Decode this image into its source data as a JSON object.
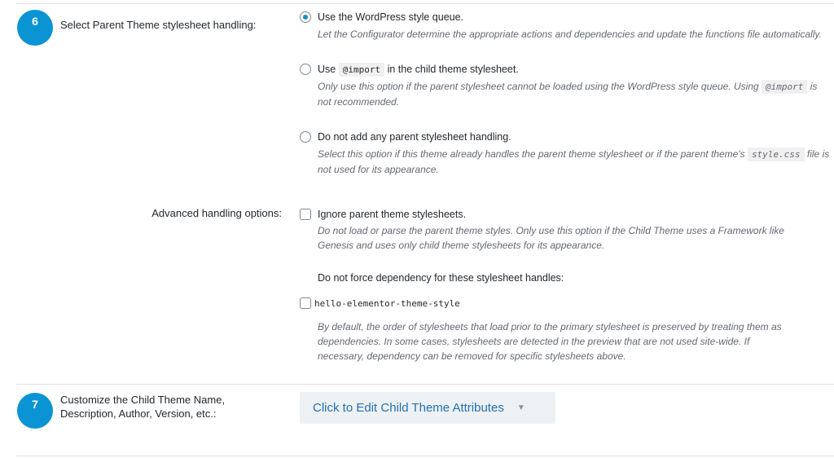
{
  "step6": {
    "number": "6",
    "label": "Select Parent Theme stylesheet handling:",
    "options": [
      {
        "title": "Use the WordPress style queue.",
        "checked": true,
        "desc": "Let the Configurator determine the appropriate actions and dependencies and update the functions file automatically."
      },
      {
        "title_pre": "Use",
        "title_code": "@import",
        "title_post": "in the child theme stylesheet.",
        "checked": false,
        "desc_pre": "Only use this option if the parent stylesheet cannot be loaded using the WordPress style queue. Using",
        "desc_code": "@import",
        "desc_post": "is not recommended."
      },
      {
        "title": "Do not add any parent stylesheet handling.",
        "checked": false,
        "desc_pre": "Select this option if this theme already handles the parent theme stylesheet or if the parent theme's",
        "desc_code": "style.css",
        "desc_post": "file is not used for its appearance."
      }
    ]
  },
  "advanced": {
    "label": "Advanced handling options:",
    "ignore_title": "Ignore parent theme stylesheets.",
    "ignore_checked": false,
    "ignore_desc": "Do not load or parse the parent theme styles. Only use this option if the Child Theme uses a Framework like Genesis and uses only child theme stylesheets for its appearance.",
    "dependency_heading": "Do not force dependency for these stylesheet handles:",
    "handle": "hello-elementor-theme-style",
    "handle_checked": false,
    "dependency_desc": "By default, the order of stylesheets that load prior to the primary stylesheet is preserved by treating them as dependencies. In some cases, stylesheets are detected in the preview that are not used site-wide. If necessary, dependency can be removed for specific stylesheets above."
  },
  "step7": {
    "number": "7",
    "label_line1": "Customize the Child Theme Name,",
    "label_line2": "Description, Author, Version, etc.:",
    "button_label": "Click to Edit Child Theme Attributes",
    "button_icon": "caret-down-icon"
  },
  "colors": {
    "accent": "#0b94d3",
    "link": "#2271b1"
  }
}
